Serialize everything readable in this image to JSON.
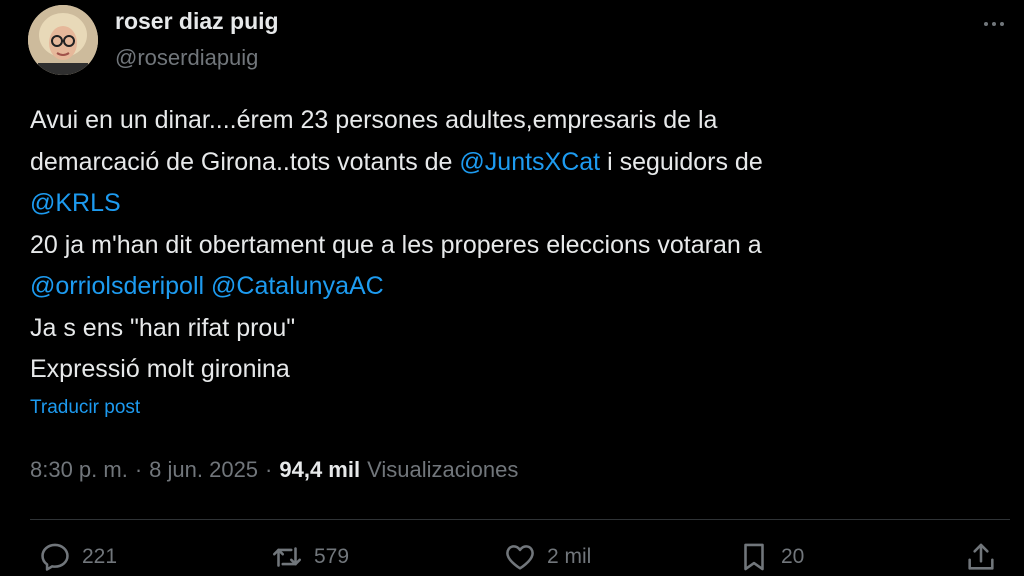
{
  "author": {
    "display_name": "roser diaz puig",
    "handle": "@roserdiapuig"
  },
  "tweet": {
    "line1": "Avui en un dinar....érem 23 persones adultes,empresaris de la",
    "line2_text": "demarcació de Girona..tots votants de ",
    "mention_juntsxcat": "@JuntsXCat",
    "line2_tail": " i seguidors de",
    "mention_krls": "@KRLS",
    "line4": "20 ja m'han dit obertament que a les properes eleccions votaran a",
    "mention_orriols": "@orriolsderipoll",
    "mention_catalunyaac": "@CatalunyaAC",
    "line6": "Ja s ens \"han rifat prou\"",
    "line7": "Expressió molt gironina"
  },
  "translate_label": "Traducir post",
  "meta": {
    "time": "8:30 p. m.",
    "separator": "·",
    "date": "8 jun. 2025",
    "views_count": "94,4 mil",
    "views_label": "Visualizaciones"
  },
  "actions": {
    "replies": "221",
    "reposts": "579",
    "likes": "2 mil",
    "bookmarks": "20"
  },
  "colors": {
    "background": "#000000",
    "text": "#e7e9ea",
    "secondary": "#71767b",
    "accent": "#1d9bf0",
    "divider": "#2f3336"
  },
  "icons": {
    "more": "more-dots-icon",
    "reply": "reply-icon",
    "repost": "repost-icon",
    "like": "heart-icon",
    "bookmark": "bookmark-icon",
    "share": "share-icon"
  }
}
